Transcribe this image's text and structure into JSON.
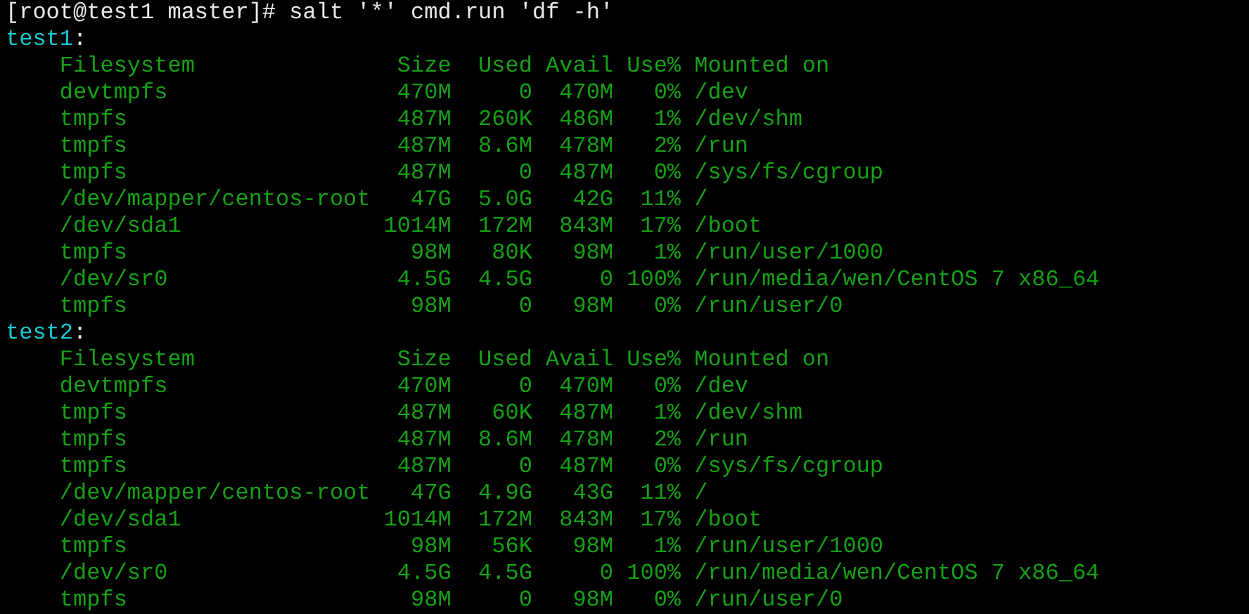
{
  "prompt": "[root@test1 master]# salt '*' cmd.run 'df -h'",
  "minions": [
    {
      "name": "test1",
      "separator": ":",
      "columns": [
        "Filesystem",
        "Size",
        "Used",
        "Avail",
        "Use%",
        "Mounted on"
      ],
      "rows": [
        [
          "devtmpfs",
          "470M",
          "0",
          "470M",
          "0%",
          "/dev"
        ],
        [
          "tmpfs",
          "487M",
          "260K",
          "486M",
          "1%",
          "/dev/shm"
        ],
        [
          "tmpfs",
          "487M",
          "8.6M",
          "478M",
          "2%",
          "/run"
        ],
        [
          "tmpfs",
          "487M",
          "0",
          "487M",
          "0%",
          "/sys/fs/cgroup"
        ],
        [
          "/dev/mapper/centos-root",
          "47G",
          "5.0G",
          "42G",
          "11%",
          "/"
        ],
        [
          "/dev/sda1",
          "1014M",
          "172M",
          "843M",
          "17%",
          "/boot"
        ],
        [
          "tmpfs",
          "98M",
          "80K",
          "98M",
          "1%",
          "/run/user/1000"
        ],
        [
          "/dev/sr0",
          "4.5G",
          "4.5G",
          "0",
          "100%",
          "/run/media/wen/CentOS 7 x86_64"
        ],
        [
          "tmpfs",
          "98M",
          "0",
          "98M",
          "0%",
          "/run/user/0"
        ]
      ]
    },
    {
      "name": "test2",
      "separator": ":",
      "columns": [
        "Filesystem",
        "Size",
        "Used",
        "Avail",
        "Use%",
        "Mounted on"
      ],
      "rows": [
        [
          "devtmpfs",
          "470M",
          "0",
          "470M",
          "0%",
          "/dev"
        ],
        [
          "tmpfs",
          "487M",
          "60K",
          "487M",
          "1%",
          "/dev/shm"
        ],
        [
          "tmpfs",
          "487M",
          "8.6M",
          "478M",
          "2%",
          "/run"
        ],
        [
          "tmpfs",
          "487M",
          "0",
          "487M",
          "0%",
          "/sys/fs/cgroup"
        ],
        [
          "/dev/mapper/centos-root",
          "47G",
          "4.9G",
          "43G",
          "11%",
          "/"
        ],
        [
          "/dev/sda1",
          "1014M",
          "172M",
          "843M",
          "17%",
          "/boot"
        ],
        [
          "tmpfs",
          "98M",
          "56K",
          "98M",
          "1%",
          "/run/user/1000"
        ],
        [
          "/dev/sr0",
          "4.5G",
          "4.5G",
          "0",
          "100%",
          "/run/media/wen/CentOS 7 x86_64"
        ],
        [
          "tmpfs",
          "98M",
          "0",
          "98M",
          "0%",
          "/run/user/0"
        ]
      ]
    }
  ]
}
